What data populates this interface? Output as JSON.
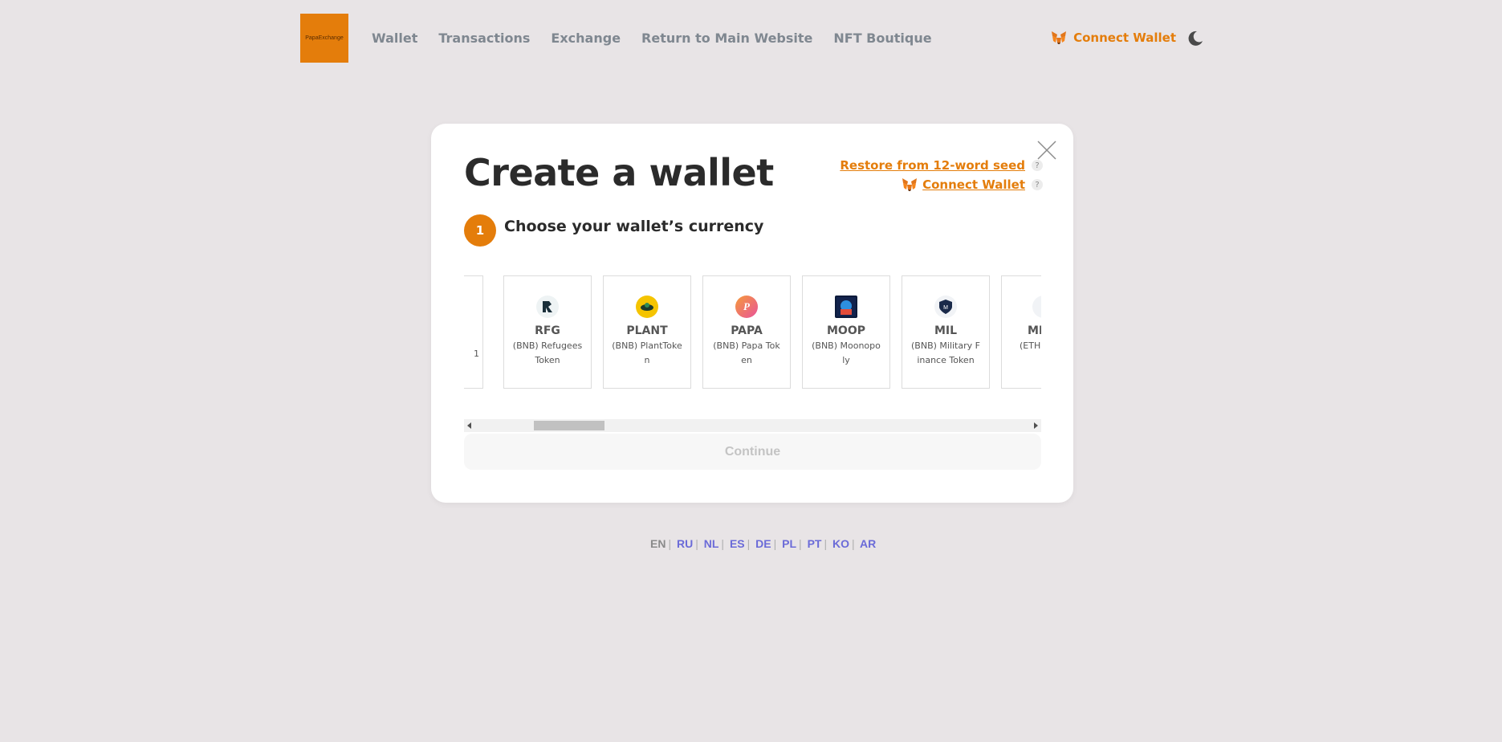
{
  "header": {
    "logo_text": "PapaExchange",
    "nav": [
      "Wallet",
      "Transactions",
      "Exchange",
      "Return to Main Website",
      "NFT Boutique"
    ],
    "connect_wallet": "Connect Wallet"
  },
  "modal": {
    "title": "Create a wallet",
    "restore_link": "Restore from 12-word seed",
    "connect_link": "Connect Wallet",
    "help_glyph": "?",
    "step_number": "1",
    "step_label": "Choose your wallet’s currency",
    "continue_label": "Continue",
    "currencies": [
      {
        "symbol": "",
        "name": "1",
        "icon": "partial-card"
      },
      {
        "symbol": "RFG",
        "name": "(BNB) Refugees Token",
        "icon": "rfg-icon",
        "color": "#1a2f3a"
      },
      {
        "symbol": "PLANT",
        "name": "(BNB) PlantToken",
        "icon": "plant-icon",
        "color": "#f5c400"
      },
      {
        "symbol": "PAPA",
        "name": "(BNB) Papa Token",
        "icon": "papa-icon",
        "color": "#e9539a"
      },
      {
        "symbol": "MOOP",
        "name": "(BNB) Moonopoly",
        "icon": "moop-icon",
        "color": "#0b5aa6"
      },
      {
        "symbol": "MIL",
        "name": "(BNB) Military Finance Token",
        "icon": "mil-icon",
        "color": "#1a2a4a"
      },
      {
        "symbol": "MI",
        "name": "(ETH)",
        "icon": "partial-icon",
        "color": "#1a2a4a"
      }
    ]
  },
  "languages": [
    {
      "code": "EN",
      "active": true
    },
    {
      "code": "RU",
      "active": false
    },
    {
      "code": "NL",
      "active": false
    },
    {
      "code": "ES",
      "active": false
    },
    {
      "code": "DE",
      "active": false
    },
    {
      "code": "PL",
      "active": false
    },
    {
      "code": "PT",
      "active": false
    },
    {
      "code": "KO",
      "active": false
    },
    {
      "code": "AR",
      "active": false
    }
  ],
  "colors": {
    "accent": "#e47d0b",
    "background": "#e8e4e6",
    "lang_link": "#6b6bd8"
  }
}
